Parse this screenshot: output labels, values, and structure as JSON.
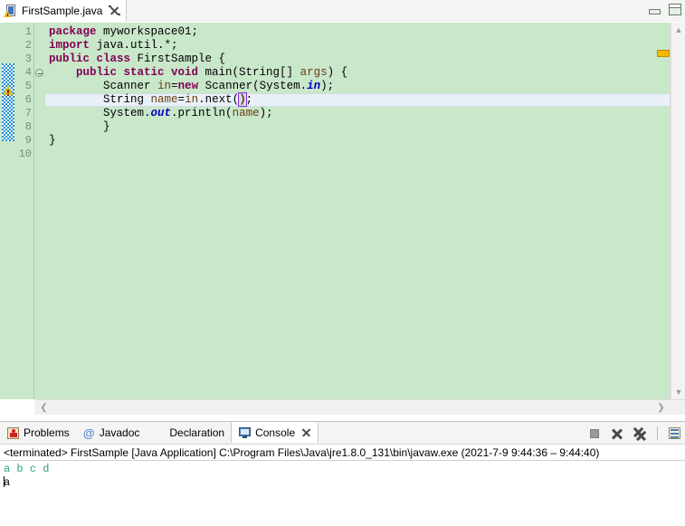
{
  "window": {
    "minimize_label": "Minimize",
    "maximize_label": "Maximize"
  },
  "editor": {
    "tab": {
      "label": "FirstSample.java",
      "icon": "java-file-warning-icon",
      "close_label": "×"
    },
    "scroll": {
      "up": "▲",
      "down": "▼",
      "left": "❮",
      "right": "❯"
    },
    "line_numbers": [
      "1",
      "2",
      "3",
      "4",
      "5",
      "6",
      "7",
      "8",
      "9",
      "10"
    ],
    "current_line": 6,
    "lines": [
      {
        "n": "1",
        "tokens": [
          {
            "t": "package ",
            "c": "kw"
          },
          {
            "t": "myworkspace01;",
            "c": "plain"
          }
        ]
      },
      {
        "n": "2",
        "tokens": [
          {
            "t": "import ",
            "c": "kw"
          },
          {
            "t": "java.util.*;",
            "c": "plain"
          }
        ]
      },
      {
        "n": "3",
        "tokens": [
          {
            "t": "public class ",
            "c": "kw"
          },
          {
            "t": "FirstSample {",
            "c": "plain"
          }
        ]
      },
      {
        "n": "4",
        "fold": true,
        "tokens": [
          {
            "t": "    ",
            "c": "plain"
          },
          {
            "t": "public static void ",
            "c": "kw"
          },
          {
            "t": "main(String[] ",
            "c": "plain"
          },
          {
            "t": "args",
            "c": "local"
          },
          {
            "t": ") {",
            "c": "plain"
          }
        ]
      },
      {
        "n": "5",
        "tokens": [
          {
            "t": "        Scanner ",
            "c": "plain"
          },
          {
            "t": "in",
            "c": "local"
          },
          {
            "t": "=",
            "c": "plain"
          },
          {
            "t": "new ",
            "c": "kw"
          },
          {
            "t": "Scanner(System.",
            "c": "plain"
          },
          {
            "t": "in",
            "c": "fieldi"
          },
          {
            "t": ");",
            "c": "plain"
          }
        ]
      },
      {
        "n": "6",
        "tokens": [
          {
            "t": "        String ",
            "c": "plain"
          },
          {
            "t": "name",
            "c": "local"
          },
          {
            "t": "=",
            "c": "plain"
          },
          {
            "t": "in",
            "c": "local"
          },
          {
            "t": ".next(",
            "c": "plain"
          },
          {
            "t": ")",
            "c": "bracket-hl"
          },
          {
            "t": ";",
            "c": "plain"
          }
        ]
      },
      {
        "n": "7",
        "tokens": [
          {
            "t": "        System.",
            "c": "plain"
          },
          {
            "t": "out",
            "c": "fieldi"
          },
          {
            "t": ".println(",
            "c": "plain"
          },
          {
            "t": "name",
            "c": "local"
          },
          {
            "t": ");",
            "c": "plain"
          }
        ]
      },
      {
        "n": "8",
        "tokens": [
          {
            "t": "        }",
            "c": "plain"
          }
        ]
      },
      {
        "n": "9",
        "tokens": [
          {
            "t": "}",
            "c": "plain"
          }
        ]
      },
      {
        "n": "10",
        "tokens": []
      }
    ],
    "annotations": {
      "warning_marker": "warning-icon",
      "change_bar": "unsaved-change-stripe"
    }
  },
  "bottom_view": {
    "tabs": [
      {
        "label": "Problems",
        "icon": "problems-icon",
        "active": false
      },
      {
        "label": "Javadoc",
        "icon": "javadoc-icon",
        "active": false
      },
      {
        "label": "Declaration",
        "icon": "declaration-icon",
        "active": false
      },
      {
        "label": "Console",
        "icon": "console-icon",
        "active": true
      }
    ],
    "toolbar": [
      {
        "name": "stop-button",
        "icon": "stop-square-icon"
      },
      {
        "name": "terminate-remove-button",
        "icon": "x-icon"
      },
      {
        "name": "remove-all-terminated-button",
        "icon": "double-x-icon"
      },
      {
        "name": "display-selected-console-button",
        "icon": "console-view-icon"
      }
    ],
    "console": {
      "header": "<terminated> FirstSample [Java Application] C:\\Program Files\\Java\\jre1.8.0_131\\bin\\javaw.exe  (2021-7-9 9:44:36 – 9:44:40)",
      "output_line": "a b c d",
      "input_line": "a"
    }
  },
  "colors": {
    "editor_background": "#c9e7c9",
    "keyword": "#7f0055",
    "static_field": "#0000c0",
    "local_variable": "#6a3e11",
    "current_line_highlight": "#e9f0f7",
    "console_output_green": "#2aa37f",
    "change_bar": "#1c8fd0",
    "overview_marker": "#f5b800"
  }
}
